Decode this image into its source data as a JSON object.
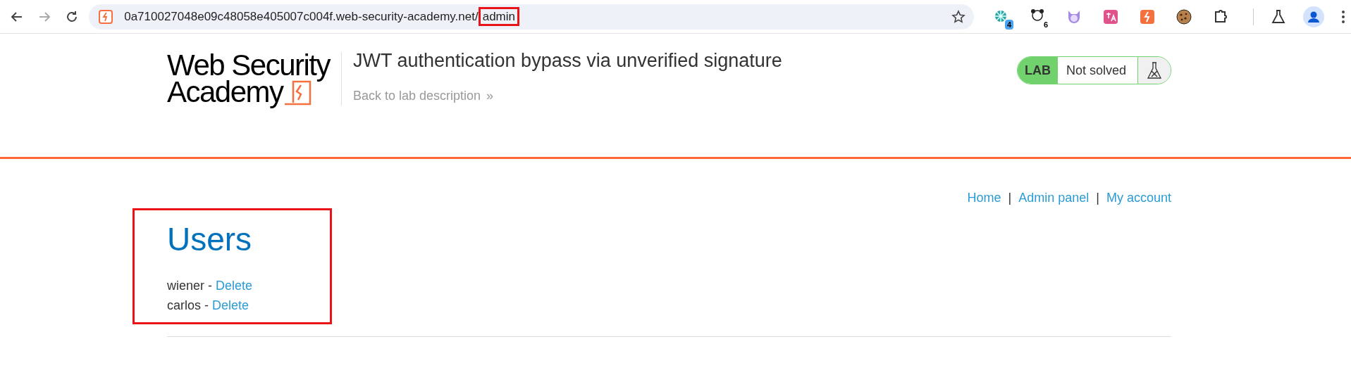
{
  "browser": {
    "url_host": "0a710027048e09c48058e405007c004f.web-security-academy.net/",
    "url_path": "admin",
    "path_highlighted": true,
    "extensions": [
      {
        "kind": "snowflake",
        "badge": "4"
      },
      {
        "kind": "panda",
        "badge": "6"
      },
      {
        "kind": "cat"
      },
      {
        "kind": "translate"
      },
      {
        "kind": "bolt"
      },
      {
        "kind": "cookie"
      },
      {
        "kind": "puzzle"
      }
    ]
  },
  "header": {
    "logo_line_1": "Web Security",
    "logo_line_2": "Academy",
    "lab_title": "JWT authentication bypass via unverified signature",
    "back_link": "Back to lab description",
    "back_arrow": "»",
    "status": {
      "label": "LAB",
      "text": "Not solved",
      "solved": false
    }
  },
  "nav": [
    {
      "label": "Home"
    },
    {
      "separator": "|",
      "label": "Admin panel"
    },
    {
      "separator": "|",
      "label": "My account"
    }
  ],
  "section": {
    "title": "Users",
    "highlighted": true,
    "users": [
      {
        "name": "wiener",
        "separator": "-",
        "action": "Delete"
      },
      {
        "name": "carlos",
        "separator": "-",
        "action": "Delete"
      }
    ]
  }
}
